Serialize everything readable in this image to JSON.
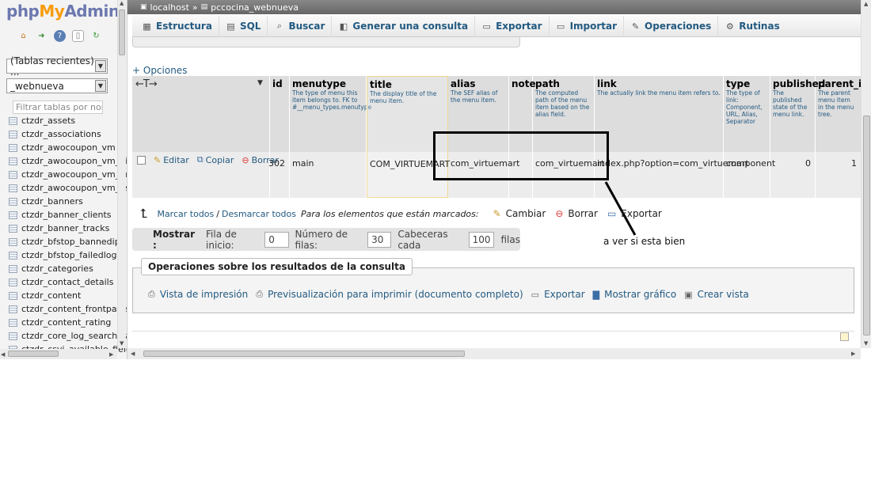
{
  "logo": {
    "php": "php",
    "my": "My",
    "admin": "Admin"
  },
  "nav": {
    "recent_select": "(Tablas recientes) ...",
    "db_select": "_webnueva",
    "filter_placeholder": "Filtrar tablas por nombr",
    "tables": [
      "ctzdr_assets",
      "ctzdr_associations",
      "ctzdr_awocoupon_vm",
      "ctzdr_awocoupon_vm_hist",
      "ctzdr_awocoupon_vm_pro",
      "ctzdr_awocoupon_vm_use",
      "ctzdr_banners",
      "ctzdr_banner_clients",
      "ctzdr_banner_tracks",
      "ctzdr_bfstop_bannedip",
      "ctzdr_bfstop_failedlogin",
      "ctzdr_categories",
      "ctzdr_contact_details",
      "ctzdr_content",
      "ctzdr_content_frontpage",
      "ctzdr_content_rating",
      "ctzdr_core_log_searches",
      "ctzdr_csvi_available_fields"
    ]
  },
  "breadcrumb": {
    "server": "localhost",
    "sep": "»",
    "database": "pccocina_webnueva"
  },
  "tabs": [
    "Estructura",
    "SQL",
    "Buscar",
    "Generar una consulta",
    "Exportar",
    "Importar",
    "Operaciones",
    "Rutinas"
  ],
  "opciones": "+ Opciones",
  "columns": [
    {
      "name": "id",
      "desc": ""
    },
    {
      "name": "menutype",
      "desc": "The type of menu this item belongs to. FK to #__menu_types.menutype"
    },
    {
      "name": "title",
      "desc": "The display title of the menu item."
    },
    {
      "name": "alias",
      "desc": "The SEF alias of the menu item."
    },
    {
      "name": "note",
      "desc": ""
    },
    {
      "name": "path",
      "desc": "The computed path of the menu item based on the alias field."
    },
    {
      "name": "link",
      "desc": "The actually link the menu item refers to."
    },
    {
      "name": "type",
      "desc": "The type of link: Component, URL, Alias, Separator"
    },
    {
      "name": "published",
      "desc": "The published state of the menu link."
    },
    {
      "name": "parent_id",
      "desc": "The parent menu item in the menu tree."
    }
  ],
  "row": {
    "edit": "Editar",
    "copy": "Copiar",
    "delete": "Borrar",
    "id": "302",
    "menutype": "main",
    "title": "COM_VIRTUEMART",
    "alias": "com_virtuemart",
    "note": "",
    "path": "com_virtuemart",
    "link": "index.php?option=com_virtuemart",
    "type": "component",
    "published": "0",
    "parent_id": "1"
  },
  "bulk": {
    "check_all": "Marcar todos",
    "sep": "/",
    "uncheck_all": "Desmarcar todos",
    "with_selected": "Para los elementos que están marcados:",
    "change": "Cambiar",
    "delete": "Borrar",
    "export": "Exportar"
  },
  "pager": {
    "show": "Mostrar :",
    "start_label": "Fila de inicio:",
    "start": "0",
    "rows_label": "Número de filas:",
    "rows": "30",
    "headers_label": "Cabeceras cada",
    "headers": "100",
    "rows_suffix": "filas"
  },
  "annotation": "a ver si esta bien",
  "ops": {
    "title": "Operaciones sobre los resultados de la consulta",
    "print": "Vista de impresión",
    "print_preview": "Previsualización para imprimir (documento completo)",
    "export": "Exportar",
    "chart": "Mostrar gráfico",
    "view": "Crear vista"
  }
}
